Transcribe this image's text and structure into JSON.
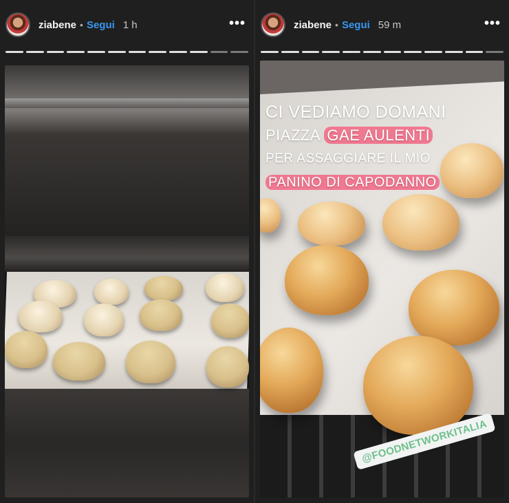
{
  "stories": [
    {
      "username": "ziabene",
      "separator": "•",
      "follow_label": "Segui",
      "time": "1 h",
      "more_icon": "more-horizontal-icon",
      "more_label": "•••",
      "progress": {
        "segments": 12,
        "viewed": 10
      }
    },
    {
      "username": "ziabene",
      "separator": "•",
      "follow_label": "Segui",
      "time": "59 m",
      "more_icon": "more-horizontal-icon",
      "more_label": "•••",
      "progress": {
        "segments": 12,
        "viewed": 11
      },
      "caption": {
        "line1": "CI VEDIAMO DOMANI",
        "line2_plain": "PIAZZA",
        "line2_highlight": "GAE AULENTI",
        "line3": "PER ASSAGGIARE IL MIO",
        "line4_highlight": "PANINO DI CAPODANNO"
      },
      "mention_tag": "@FOODNETWORKITALIA"
    }
  ],
  "colors": {
    "background": "#262626",
    "follow": "#3897f0",
    "highlight": "#f07890",
    "mention_text": "#6fbf8e"
  }
}
